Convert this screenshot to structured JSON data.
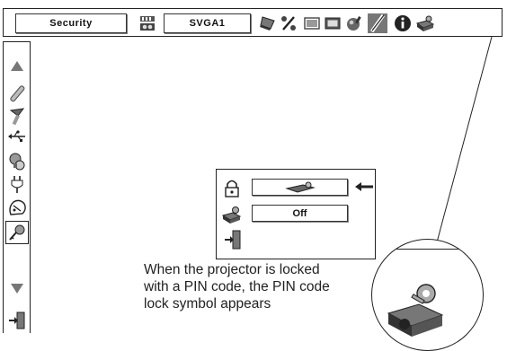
{
  "topbar": {
    "menu_label": "Security",
    "input_source": "SVGA1"
  },
  "dialog": {
    "pin_lock_value": "Off"
  },
  "description": "When the projector is locked with a PIN code, the PIN code lock symbol appears",
  "icons": {
    "top": [
      "memory-card-icon",
      "notebook-pc-icon",
      "percent-icon",
      "screen-icon",
      "screen-frame-icon",
      "color-icon",
      "pencil-icon",
      "info-icon",
      "key-lock-icon"
    ],
    "sidebar": [
      "triangle-up-icon",
      "pen-icon",
      "brush-icon",
      "usb-icon",
      "lamp-icon",
      "plug-icon",
      "power-management-icon",
      "security-key-icon",
      "triangle-down-icon",
      "exit-icon"
    ],
    "dialog": [
      "padlock-icon",
      "key-pin-icon",
      "exit-icon",
      "left-arrow-icon"
    ]
  },
  "colors": {
    "border": "#222222",
    "background": "#ffffff",
    "icon_gray": "#8a8a8a"
  }
}
